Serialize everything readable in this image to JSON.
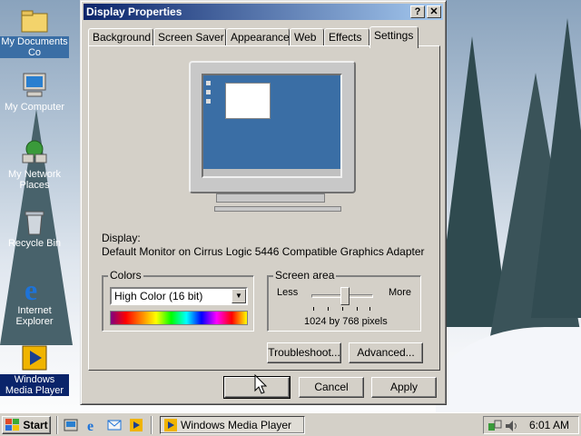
{
  "desktop": {
    "icons": [
      {
        "label": "My Documents Co",
        "icon": "folder-icon"
      },
      {
        "label": "My Computer",
        "icon": "computer-icon"
      },
      {
        "label": "My Network Places",
        "icon": "network-icon"
      },
      {
        "label": "Recycle Bin",
        "icon": "recycle-bin-icon"
      },
      {
        "label": "Internet Explorer",
        "icon": "internet-explorer-icon"
      },
      {
        "label": "Windows Media Player",
        "icon": "media-player-icon"
      }
    ]
  },
  "window": {
    "title": "Display Properties",
    "help_btn": "?",
    "close_btn": "✕",
    "tabs": [
      "Background",
      "Screen Saver",
      "Appearance",
      "Web",
      "Effects",
      "Settings"
    ],
    "active_tab": "Settings",
    "display_label": "Display:",
    "display_value": "Default Monitor on Cirrus Logic 5446 Compatible Graphics Adapter",
    "colors": {
      "legend": "Colors",
      "selected": "High Color (16 bit)"
    },
    "screen_area": {
      "legend": "Screen area",
      "less": "Less",
      "more": "More",
      "resolution": "1024 by 768 pixels",
      "slider_position": 0.55
    },
    "troubleshoot_btn": "Troubleshoot...",
    "advanced_btn": "Advanced...",
    "ok_btn": "",
    "cancel_btn": "Cancel",
    "apply_btn": "Apply"
  },
  "taskbar": {
    "start_label": "Start",
    "quick_launch": [
      "show-desktop-icon",
      "internet-explorer-icon",
      "outlook-express-icon",
      "media-player-icon"
    ],
    "task_label": "Windows Media Player",
    "clock": "6:01 AM",
    "tray_icons": [
      "network-tray-icon",
      "volume-icon"
    ]
  },
  "colors": {
    "title_active": "#0a246a",
    "title_gradient_end": "#a6caf0",
    "face": "#d4d0c8",
    "desktop_screen": "#3a6ea5"
  }
}
